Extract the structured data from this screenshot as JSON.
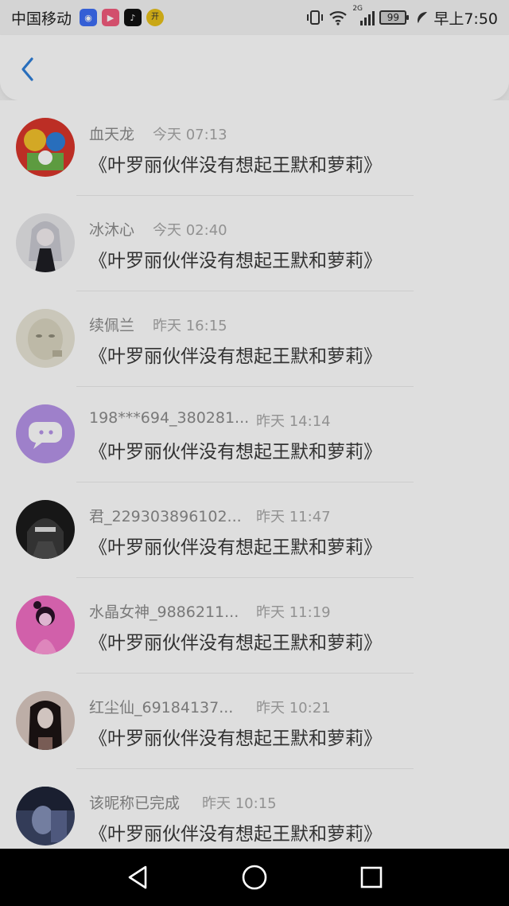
{
  "status_bar": {
    "carrier": "中国移动",
    "apps": [
      {
        "name": "browser-app-icon",
        "color": "#3d6ef5",
        "glyph": "◉"
      },
      {
        "name": "video-app-icon",
        "color": "#f25b7c",
        "glyph": "▶"
      },
      {
        "name": "tiktok-app-icon",
        "color": "#111111",
        "glyph": "♪"
      },
      {
        "name": "yellow-app-icon",
        "color": "#e7c01a",
        "glyph": "开"
      }
    ],
    "network": "2G",
    "battery": "99",
    "time": "早上7:50"
  },
  "header": {
    "back_label": "back"
  },
  "messages": [
    {
      "name": "血天龙",
      "time": "今天 07:13",
      "text": "《叶罗丽伙伴没有想起王默和萝莉》",
      "avatar": {
        "bg": "#d8352b",
        "fg": "#2e7fd8",
        "accent": "#f3c12b"
      }
    },
    {
      "name": "冰沐心",
      "time": "今天 02:40",
      "text": "《叶罗丽伙伴没有想起王默和萝莉》",
      "avatar": {
        "bg": "#e7e7ea",
        "fg": "#1e1e24",
        "accent": "#c9c9d2"
      }
    },
    {
      "name": "续佩兰",
      "time": "昨天 16:15",
      "text": "《叶罗丽伙伴没有想起王默和萝莉》",
      "avatar": {
        "bg": "#e8e5d6",
        "fg": "#c5c1a8",
        "accent": "#8f8c7a"
      }
    },
    {
      "name": "198***694_380281...",
      "time": "昨天 14:14",
      "text": "《叶罗丽伙伴没有想起王默和萝莉》",
      "avatar": {
        "bg": "#b693e8",
        "fg": "#ffffff",
        "accent": "#b693e8"
      }
    },
    {
      "name": "君_229303896102...",
      "time": "昨天 11:47",
      "text": "《叶罗丽伙伴没有想起王默和萝莉》",
      "avatar": {
        "bg": "#1b1b1b",
        "fg": "#4d4d4d",
        "accent": "#e0e0e0"
      }
    },
    {
      "name": "水晶女神_9886211...",
      "time": "昨天 11:19",
      "text": "《叶罗丽伙伴没有想起王默和萝莉》",
      "avatar": {
        "bg": "#f16fc4",
        "fg": "#2a1228",
        "accent": "#ffd0ef"
      }
    },
    {
      "name": "红尘仙_69184137...",
      "time": "昨天 10:21",
      "text": "《叶罗丽伙伴没有想起王默和萝莉》",
      "avatar": {
        "bg": "#d9c8c0",
        "fg": "#1c1414",
        "accent": "#8a6a62"
      }
    },
    {
      "name": "该昵称已完成",
      "time": "昨天 10:15",
      "text": "《叶罗丽伙伴没有想起王默和萝莉》",
      "avatar": {
        "bg": "#3b4666",
        "fg": "#8591b8",
        "accent": "#1e2438"
      }
    }
  ],
  "nav": {
    "back": "back",
    "home": "home",
    "recents": "recents"
  },
  "colors": {
    "accent": "#2e7fd8",
    "name_text": "#8b8b8b",
    "time_text": "#a8a8a8",
    "message_text": "#3a3a3a"
  }
}
